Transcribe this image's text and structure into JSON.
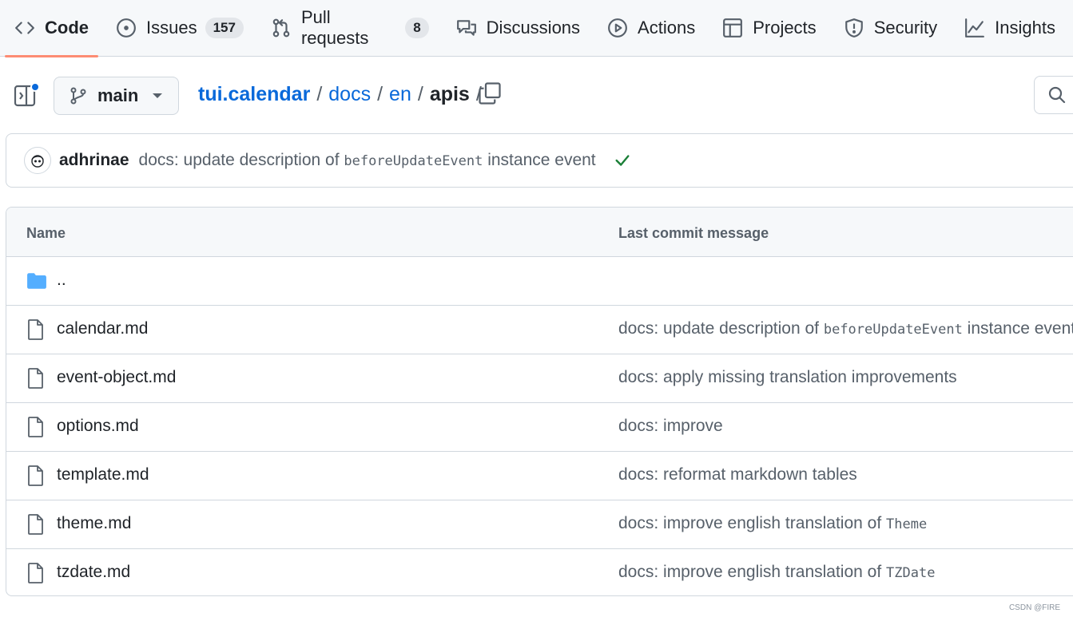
{
  "nav": {
    "tabs": [
      {
        "label": "Code",
        "icon": "code-icon",
        "active": true
      },
      {
        "label": "Issues",
        "icon": "issue-opened-icon",
        "count": "157"
      },
      {
        "label": "Pull requests",
        "icon": "git-pull-request-icon",
        "count": "8"
      },
      {
        "label": "Discussions",
        "icon": "comment-discussion-icon"
      },
      {
        "label": "Actions",
        "icon": "play-icon"
      },
      {
        "label": "Projects",
        "icon": "table-icon"
      },
      {
        "label": "Security",
        "icon": "shield-icon"
      },
      {
        "label": "Insights",
        "icon": "graph-icon"
      }
    ]
  },
  "branch": {
    "name": "main"
  },
  "breadcrumb": {
    "root": "tui.calendar",
    "parts": [
      "docs",
      "en"
    ],
    "current": "apis",
    "separator": "/"
  },
  "commit": {
    "author": "adhrinae",
    "message_prefix": "docs: update description of ",
    "message_code": "beforeUpdateEvent",
    "message_suffix": " instance event",
    "status": "success"
  },
  "table": {
    "headers": {
      "name": "Name",
      "message": "Last commit message"
    },
    "parent_dir": "..",
    "files": [
      {
        "name": "calendar.md",
        "msg": "docs: update description of ",
        "code": "beforeUpdateEvent",
        "suffix": " instance event"
      },
      {
        "name": "event-object.md",
        "msg": "docs: apply missing translation improvements",
        "code": "",
        "suffix": ""
      },
      {
        "name": "options.md",
        "msg": "docs: improve",
        "code": "",
        "suffix": ""
      },
      {
        "name": "template.md",
        "msg": "docs: reformat markdown tables",
        "code": "",
        "suffix": ""
      },
      {
        "name": "theme.md",
        "msg": "docs: improve english translation of ",
        "code": "Theme",
        "suffix": ""
      },
      {
        "name": "tzdate.md",
        "msg": "docs: improve english translation of ",
        "code": "TZDate",
        "suffix": ""
      }
    ]
  },
  "watermark": "CSDN @FIRE",
  "colors": {
    "accent": "#0969da",
    "active_underline": "#fd8c73",
    "success": "#1a7f37",
    "folder": "#54aeff"
  }
}
